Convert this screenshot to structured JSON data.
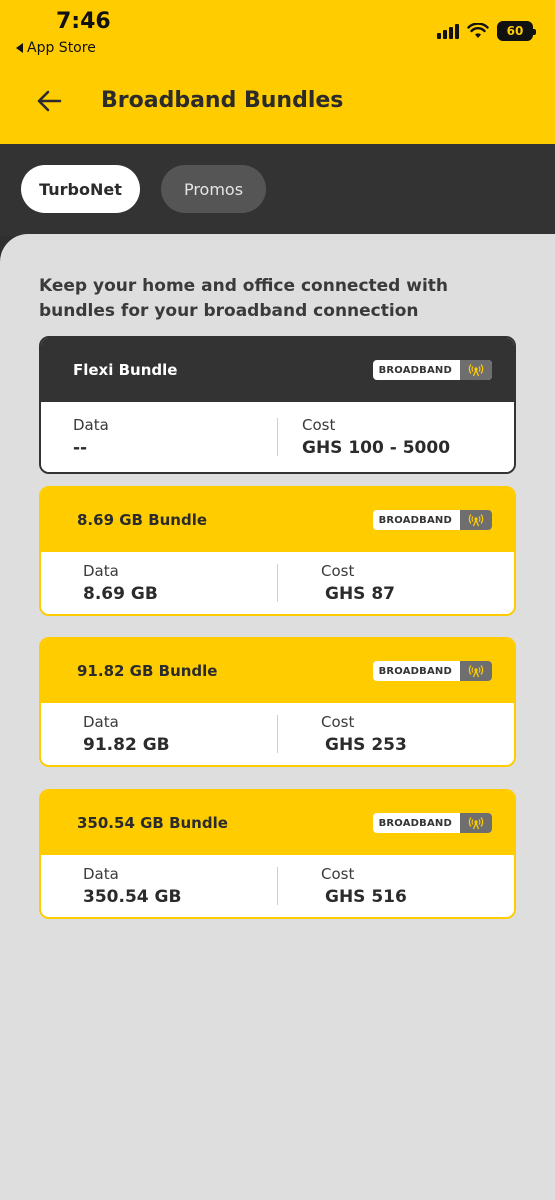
{
  "status_bar": {
    "time": "7:46",
    "back_label": "App Store",
    "battery": "60"
  },
  "header": {
    "title": "Broadband Bundles"
  },
  "tabs": [
    {
      "label": "TurboNet",
      "active": true
    },
    {
      "label": "Promos",
      "active": false
    }
  ],
  "intro": "Keep your home and office connected with bundles for your broadband connection",
  "bundles": [
    {
      "name": "Flexi Bundle",
      "badge": "BROADBAND",
      "data_label": "Data",
      "data_value": "--",
      "cost_label": "Cost",
      "cost_value": "GHS  100 - 5000"
    },
    {
      "name": "8.69 GB  Bundle",
      "badge": "BROADBAND",
      "data_label": "Data",
      "data_value": "8.69 GB",
      "cost_label": "Cost",
      "cost_value": "GHS 87"
    },
    {
      "name": "91.82 GB  Bundle",
      "badge": "BROADBAND",
      "data_label": "Data",
      "data_value": "91.82 GB",
      "cost_label": "Cost",
      "cost_value": "GHS 253"
    },
    {
      "name": "350.54 GB  Bundle",
      "badge": "BROADBAND",
      "data_label": "Data",
      "data_value": "350.54 GB",
      "cost_label": "Cost",
      "cost_value": "GHS 516"
    }
  ],
  "icons": {
    "back": "arrow-left-icon",
    "badge": "antenna-icon",
    "signal": "cellular-signal-icon",
    "wifi": "wifi-icon"
  },
  "colors": {
    "brand_yellow": "#ffcc00",
    "dark": "#333333",
    "background": "#dedede"
  }
}
